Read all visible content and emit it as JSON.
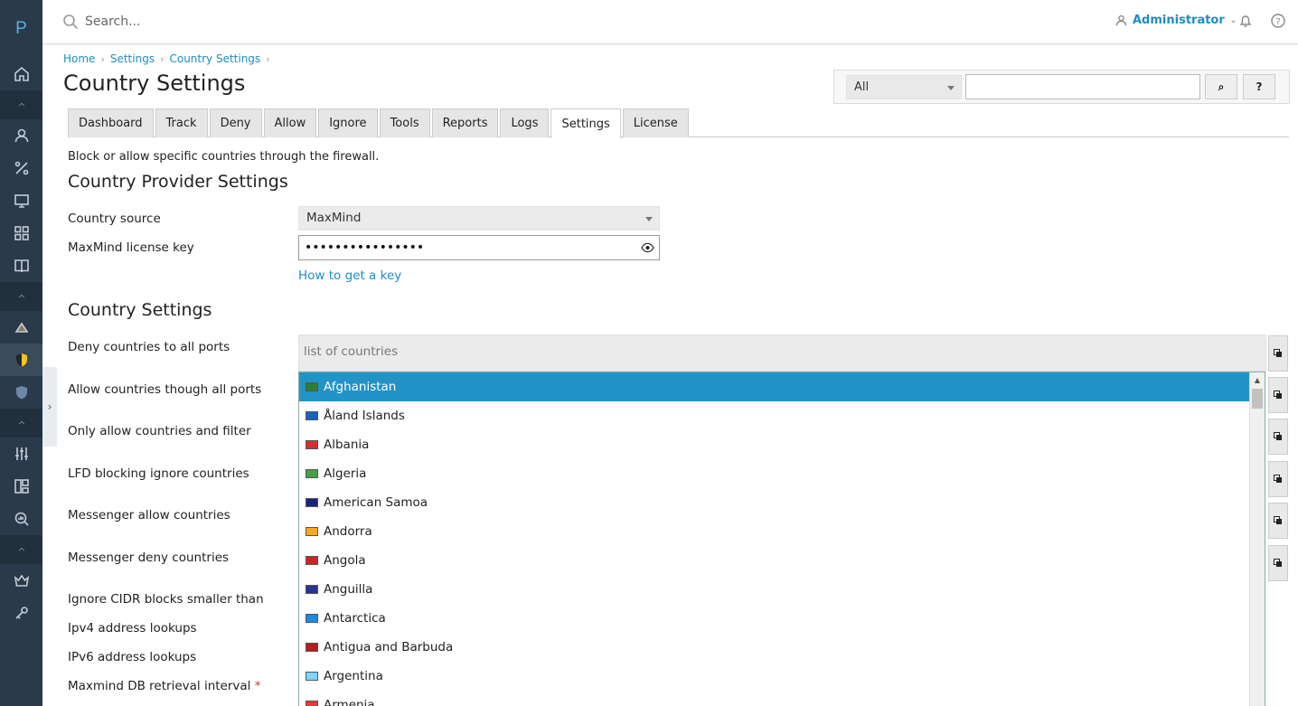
{
  "rail": {
    "logo": "P",
    "items": [
      {
        "icon": "home-icon"
      },
      {
        "icon": "chevron-up-icon",
        "kind": "section"
      },
      {
        "icon": "user-icon"
      },
      {
        "icon": "percent-icon"
      },
      {
        "icon": "monitor-icon"
      },
      {
        "icon": "grid-icon"
      },
      {
        "icon": "book-icon"
      },
      {
        "icon": "chevron-up-icon",
        "kind": "section"
      },
      {
        "icon": "plugin-icon"
      },
      {
        "icon": "shield-icon",
        "active": true
      },
      {
        "icon": "shield-gray-icon"
      },
      {
        "icon": "chevron-up-icon",
        "kind": "section"
      },
      {
        "icon": "sliders-icon"
      },
      {
        "icon": "blocks-icon"
      },
      {
        "icon": "search-stats-icon"
      },
      {
        "icon": "chevron-up-icon",
        "kind": "section"
      },
      {
        "icon": "crown-icon"
      },
      {
        "icon": "key-icon"
      }
    ]
  },
  "topbar": {
    "search_placeholder": "Search...",
    "user_label": "Administrator"
  },
  "breadcrumb": [
    "Home",
    "Settings",
    "Country Settings"
  ],
  "page_title": "Country Settings",
  "filter": {
    "select_value": "All",
    "search_button": "⌕",
    "help_button": "?"
  },
  "tabs": [
    "Dashboard",
    "Track",
    "Deny",
    "Allow",
    "Ignore",
    "Tools",
    "Reports",
    "Logs",
    "Settings",
    "License"
  ],
  "active_tab": "Settings",
  "intro": "Block or allow specific countries through the firewall.",
  "provider": {
    "heading": "Country Provider Settings",
    "source_label": "Country source",
    "source_value": "MaxMind",
    "key_label": "MaxMind license key",
    "key_value": "••••••••••••••••",
    "key_link": "How to get a key"
  },
  "country_settings": {
    "heading": "Country Settings",
    "labels": [
      "Deny countries to all ports",
      "Allow countries though all ports",
      "Only allow countries and filter",
      "LFD blocking ignore countries",
      "Messenger allow countries",
      "Messenger deny countries",
      "Ignore CIDR blocks smaller than",
      "Ipv4 address lookups",
      "IPv6 address lookups",
      "Maxmind DB retrieval interval"
    ],
    "required_mark": "*",
    "countries_placeholder": "list of countries"
  },
  "dropdown": {
    "options": [
      {
        "name": "Afghanistan",
        "flag": "#2e7d32",
        "selected": true
      },
      {
        "name": "Åland Islands",
        "flag": "#1565c0"
      },
      {
        "name": "Albania",
        "flag": "#d32f2f"
      },
      {
        "name": "Algeria",
        "flag": "#43a047"
      },
      {
        "name": "American Samoa",
        "flag": "#1a237e"
      },
      {
        "name": "Andorra",
        "flag": "#f9a825"
      },
      {
        "name": "Angola",
        "flag": "#c62828"
      },
      {
        "name": "Anguilla",
        "flag": "#283593"
      },
      {
        "name": "Antarctica",
        "flag": "#1e88e5"
      },
      {
        "name": "Antigua and Barbuda",
        "flag": "#b71c1c"
      },
      {
        "name": "Argentina",
        "flag": "#81d4fa"
      },
      {
        "name": "Armenia",
        "flag": "#e53935"
      }
    ]
  },
  "colors": {
    "accent": "#1f8cc2",
    "selected": "#2293c7",
    "rail": "#2b3a4a"
  }
}
